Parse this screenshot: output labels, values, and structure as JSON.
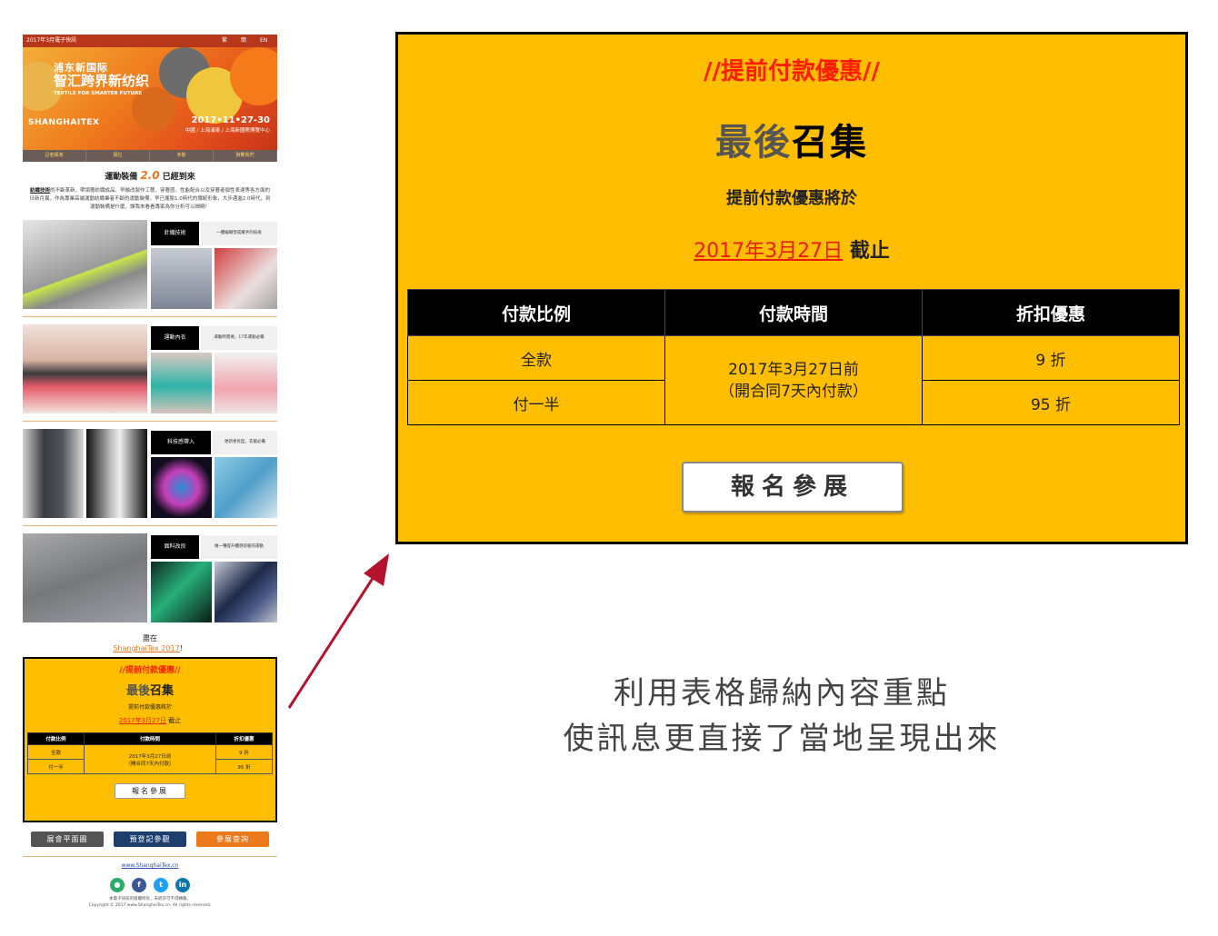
{
  "newsletter": {
    "topbar": {
      "title": "2017年3月電子快訊",
      "lang1": "繁",
      "lang2": "簡",
      "lang3": "EN"
    },
    "header": {
      "headline1": "浦东新国际",
      "headline2": "智汇跨界新纺织",
      "headline3": "TEXTILE FOR SMARTER FUTURE",
      "logo": "SHANGHAITEX",
      "date": "2017•11•27-30",
      "venue": "中國 / 上海浦東 / 上海新國際博覽中心"
    },
    "nav": [
      "記者報導",
      "展位",
      "參觀",
      "聯繫我們"
    ],
    "title_pre": "運動裝備",
    "title_hl": "2.0",
    "title_post": "已經到來",
    "intro_u": "紡織技術",
    "intro": "的不斷革新，帶領著紡織成品、早融改製作工藝、穿著感、性能配合以及穿著者個性表達等各方面的日新月異，作為專業高端運動紡織業者不斷的運動裝備，早已擺脫1.0時代的傳統形象，大步邁進2.0時代，到運動裝備是什麼，讓我來看看專家為你分析可以揭曉！",
    "sections": [
      {
        "label": "針織技術",
        "desc": "一體編織塑成羅手的技術"
      },
      {
        "label": "運動內衣",
        "desc": "運動時需要，17年運動必備"
      },
      {
        "label": "科技感帶入",
        "desc": "更新更有型，衣服必備"
      },
      {
        "label": "面料改良",
        "desc": "做一種提升體感舒服的運動"
      }
    ],
    "visit_line1": "盡在",
    "visit_link": "ShanghaiTex 2017",
    "visit_end": "！",
    "mini": {
      "promo": "//提前付款優惠//",
      "big_gray": "最後",
      "big_black": "召集",
      "small": "提前付款優惠將於",
      "date_red": "2017年3月27日",
      "date_end": "截止",
      "headers": [
        "付款比例",
        "付款時間",
        "折扣優惠"
      ],
      "row1": [
        "全款",
        "9 折"
      ],
      "row2": [
        "付一半",
        "95 折"
      ],
      "mid_line1": "2017年3月27日前",
      "mid_line2": "（開合同7天內付款）",
      "button": "報名參展"
    },
    "buttons": [
      "展會平面圖",
      "預登記參觀",
      "參展查詢"
    ],
    "site": "www.ShanghaiTex.cn",
    "copy1": "本電子快訊的版權所有，未經許可不得轉載。",
    "copy2": "Copyright © 2017 www.ShanghaiTex.cn. All rights reserved."
  },
  "card": {
    "promo": "//提前付款優惠//",
    "big_gray": "最後",
    "big_black": "召集",
    "ends": "提前付款優惠將於",
    "date_red": "2017年3月27日",
    "date_end": " 截止",
    "headers": [
      "付款比例",
      "付款時間",
      "折扣優惠"
    ],
    "row1": [
      "全款",
      "9 折"
    ],
    "row2": [
      "付一半",
      "95 折"
    ],
    "mid_line1": "2017年3月27日前",
    "mid_line2": "（開合同7天內付款）",
    "button": "報名參展"
  },
  "caption": {
    "line1": "利用表格歸納內容重點",
    "line2": "使訊息更直接了當地呈現出來"
  },
  "colors": {
    "yellow": "#ffbf00",
    "red": "#ff1d00",
    "orange": "#e8761e",
    "arrow": "#b3132b"
  }
}
